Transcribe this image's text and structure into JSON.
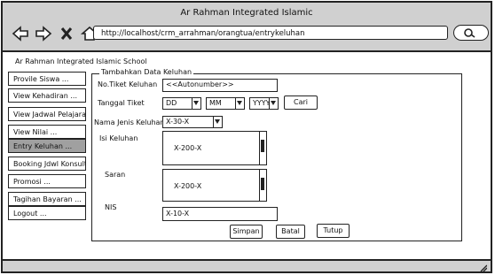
{
  "window": {
    "title": "Ar Rahman Integrated Islamic",
    "url": "http://localhost/crm_arrahman/orangtua/entrykeluhan"
  },
  "header": {
    "school_name": "Ar Rahman Integrated Islamic School"
  },
  "sidebar": {
    "items": [
      {
        "label": "Provile Siswa   ..."
      },
      {
        "label": "View Kehadiran   ..."
      },
      {
        "label": "View Jadwal Pelajaran"
      },
      {
        "label": "View Nilai   ..."
      },
      {
        "label": "Entry Keluhan   ..."
      },
      {
        "label": "Booking Jdwl Konsultasi"
      },
      {
        "label": "Promosi   ..."
      },
      {
        "label": "Tagihan Bayaran   ..."
      },
      {
        "label": "Logout   ..."
      }
    ],
    "active_index": 4
  },
  "form": {
    "legend": "Tambahkan Data Keluhan",
    "ticket_label": "No.Tiket Keluhan",
    "ticket_value": "<<Autonumber>>",
    "date_label": "Tanggal Tiket",
    "day_value": "DD",
    "month_value": "MM",
    "year_value": "YYYY",
    "search_label": "Cari",
    "type_label": "Nama Jenis Keluhan",
    "type_value": "X-30-X",
    "complaint_label": "Isi Keluhan",
    "complaint_value": "X-200-X",
    "suggestion_label": "Saran",
    "suggestion_value": "X-200-X",
    "nis_label": "NIS",
    "nis_value": "X-10-X",
    "save_label": "Simpan",
    "cancel_label": "Batal",
    "close_label": "Tutup"
  }
}
